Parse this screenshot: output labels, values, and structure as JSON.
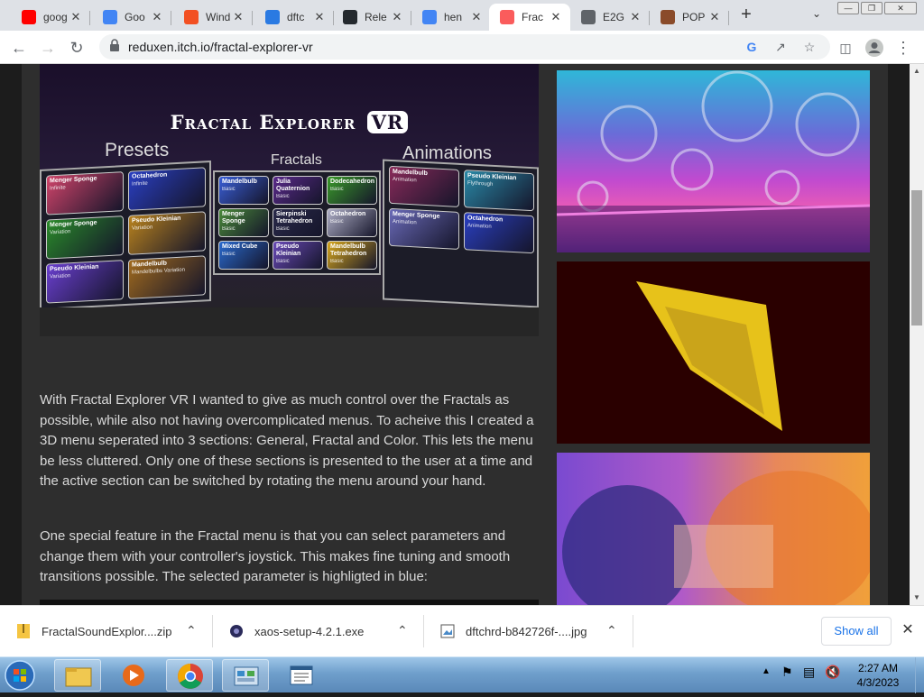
{
  "browser": {
    "tabs": [
      {
        "label": "goog",
        "icon": "youtube-icon",
        "color": "#ff0000"
      },
      {
        "label": "Goo",
        "icon": "google-translate-icon",
        "color": "#4285f4"
      },
      {
        "label": "Wind",
        "icon": "windows-icon",
        "color": "#f25022"
      },
      {
        "label": "dftc",
        "icon": "ibb-icon",
        "color": "#2a7ae2"
      },
      {
        "label": "Rele",
        "icon": "github-icon",
        "color": "#24292e"
      },
      {
        "label": "hen",
        "icon": "google-icon",
        "color": "#4285f4"
      },
      {
        "label": "Frac",
        "icon": "itchio-icon",
        "color": "#fa5c5c",
        "active": true
      },
      {
        "label": "E2G",
        "icon": "globe-icon",
        "color": "#5f6368"
      },
      {
        "label": "POP",
        "icon": "pop-icon",
        "color": "#8a4b2a"
      }
    ],
    "new_tab": "+",
    "url": "reduxen.itch.io/fractal-explorer-vr"
  },
  "hero": {
    "title": "Fractal Explorer",
    "title_badge": "VR",
    "sections": [
      "Presets",
      "Fractals",
      "Animations"
    ],
    "presets": [
      {
        "label": "Menger Sponge",
        "sub": "Infinite",
        "color": "#d0446a"
      },
      {
        "label": "Octahedron",
        "sub": "Infinite",
        "color": "#2a3fc2"
      },
      {
        "label": "Menger Sponge",
        "sub": "Variation",
        "color": "#2a8a2a"
      },
      {
        "label": "Pseudo Kleinian",
        "sub": "Variation",
        "color": "#b8821e"
      },
      {
        "label": "Pseudo Kleinian",
        "sub": "Variation",
        "color": "#6a3fcf"
      },
      {
        "label": "Mandelbulb",
        "sub": "Mandelbulbs Variation",
        "color": "#a06a1e"
      }
    ],
    "fractals": [
      {
        "label": "Mandelbulb",
        "sub": "Basic",
        "color": "#3a5fd8"
      },
      {
        "label": "Julia Quaternion",
        "sub": "Basic",
        "color": "#5a2a8a"
      },
      {
        "label": "Dodecahedron",
        "sub": "Basic",
        "color": "#3a9a2a"
      },
      {
        "label": "Menger Sponge",
        "sub": "Basic",
        "color": "#4a8a3a"
      },
      {
        "label": "Sierpinski Tetrahedron",
        "sub": "Basic",
        "color": "#2a2a4a"
      },
      {
        "label": "Octahedron",
        "sub": "Basic",
        "color": "#b0b0c8"
      },
      {
        "label": "Mixed Cube",
        "sub": "Basic",
        "color": "#2a6acf"
      },
      {
        "label": "Pseudo Kleinian",
        "sub": "Basic",
        "color": "#6a4ab8"
      },
      {
        "label": "Mandelbulb Tetrahedron",
        "sub": "Basic",
        "color": "#d8a81e"
      }
    ],
    "animations": [
      {
        "label": "Mandelbulb",
        "sub": "Animation",
        "color": "#8a2a5a"
      },
      {
        "label": "Pseudo Kleinian",
        "sub": "Flythrough",
        "color": "#2a8aa8"
      },
      {
        "label": "Menger Sponge",
        "sub": "Animation",
        "color": "#6a6ab8"
      },
      {
        "label": "Octahedron",
        "sub": "Animation",
        "color": "#2a3fc2"
      }
    ]
  },
  "article": {
    "p1": "With Fractal Explorer VR I wanted to give as much control over the Fractals as possible, while also not having overcomplicated menus. To acheive this I created a 3D menu seperated into 3 sections: General, Fractal and Color. This lets the menu be less cluttered. Only one of these sections is presented to the user at a time and the active section can be switched by rotating the menu around your hand.",
    "p2": "One special feature in the Fractal menu is that you can select parameters and change them with your controller's joystick. This makes fine tuning and smooth transitions possible. The selected parameter is highligted in blue:"
  },
  "downloads": {
    "items": [
      {
        "name": "FractalSoundExplor....zip",
        "icon": "zip-file-icon"
      },
      {
        "name": "xaos-setup-4.2.1.exe",
        "icon": "exe-file-icon"
      },
      {
        "name": "dftchrd-b842726f-....jpg",
        "icon": "image-file-icon"
      }
    ],
    "show_all": "Show all"
  },
  "taskbar": {
    "time": "2:27 AM",
    "date": "4/3/2023"
  },
  "colors": {
    "page_bg": "#1c1c1c",
    "column_bg": "#2e2e2e",
    "text": "#d9d9d9",
    "link_blue": "#1a73e8"
  }
}
